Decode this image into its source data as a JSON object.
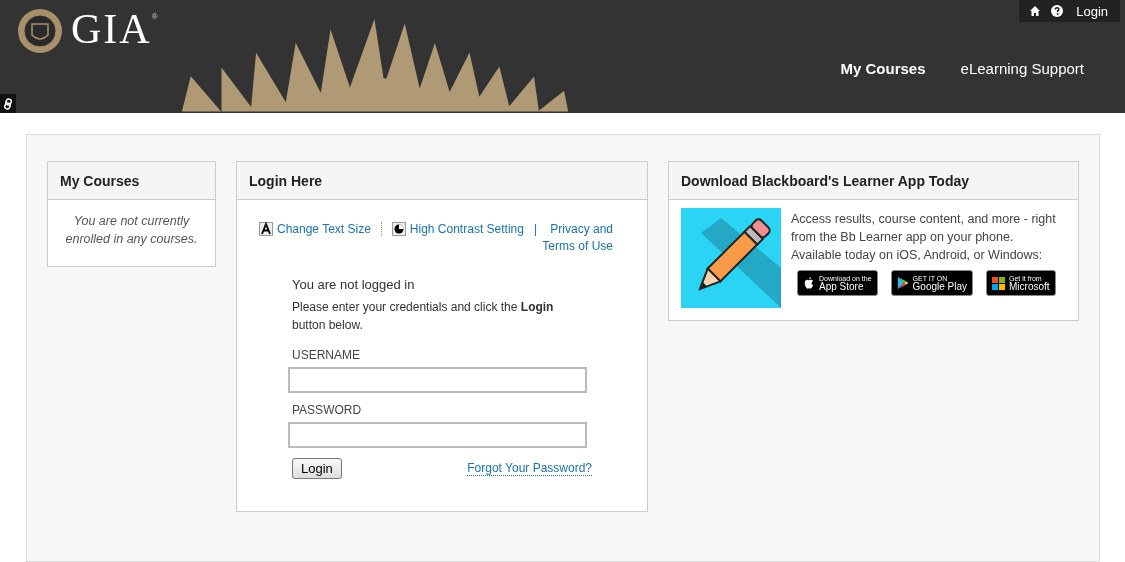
{
  "header": {
    "logo_text": "GIA",
    "registered_mark": "®",
    "utility_login": "Login",
    "nav": [
      {
        "label": "My Courses",
        "selected": true
      },
      {
        "label": "eLearning Support",
        "selected": false
      }
    ]
  },
  "my_courses": {
    "title": "My Courses",
    "message": "You are not currently enrolled in any courses."
  },
  "login": {
    "title": "Login Here",
    "tools": [
      {
        "kind": "text_size",
        "label": "Change Text Size"
      },
      {
        "kind": "contrast",
        "label": "High Contrast Setting"
      }
    ],
    "privacy_separator": "|",
    "privacy_link": "Privacy and Terms of Use",
    "status": "You are not logged in",
    "instructions": "Please enter your credentials and click the **Login** button below.",
    "fields": [
      {
        "label": "USERNAME"
      },
      {
        "label": "PASSWORD"
      }
    ],
    "button": "Login",
    "forgot_link": "Forgot Your Password?"
  },
  "app": {
    "title": "Download Blackboard's Learner App Today",
    "description": "Access results, course content, and more - right from the Bb Learner app on your phone. Available today on iOS, Android, or Windows:",
    "stores": [
      {
        "kind": "apple",
        "small": "Download on the",
        "big": "App Store"
      },
      {
        "kind": "google",
        "small": "GET IT ON",
        "big": "Google Play"
      },
      {
        "kind": "microsoft",
        "small": "Get it from",
        "big": "Microsoft"
      }
    ]
  }
}
